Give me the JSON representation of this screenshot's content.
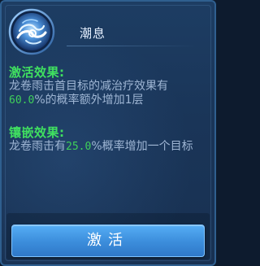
{
  "skill": {
    "name": "潮息",
    "icon": "wave-swirl-icon"
  },
  "activation": {
    "title": "激活效果:",
    "text_before": "龙卷雨击首目标的减治疗效果有",
    "value": "60.0",
    "text_after": "%的概率额外增加1层"
  },
  "inlay": {
    "title": "镶嵌效果:",
    "text_before": "龙卷雨击有",
    "value": "25.0",
    "text_after": "%概率增加一个目标"
  },
  "button": {
    "label": "激活"
  },
  "colors": {
    "accent_green": "#40e060",
    "button_blue": "#3d8fdd",
    "panel_bg": "#1a3558"
  }
}
